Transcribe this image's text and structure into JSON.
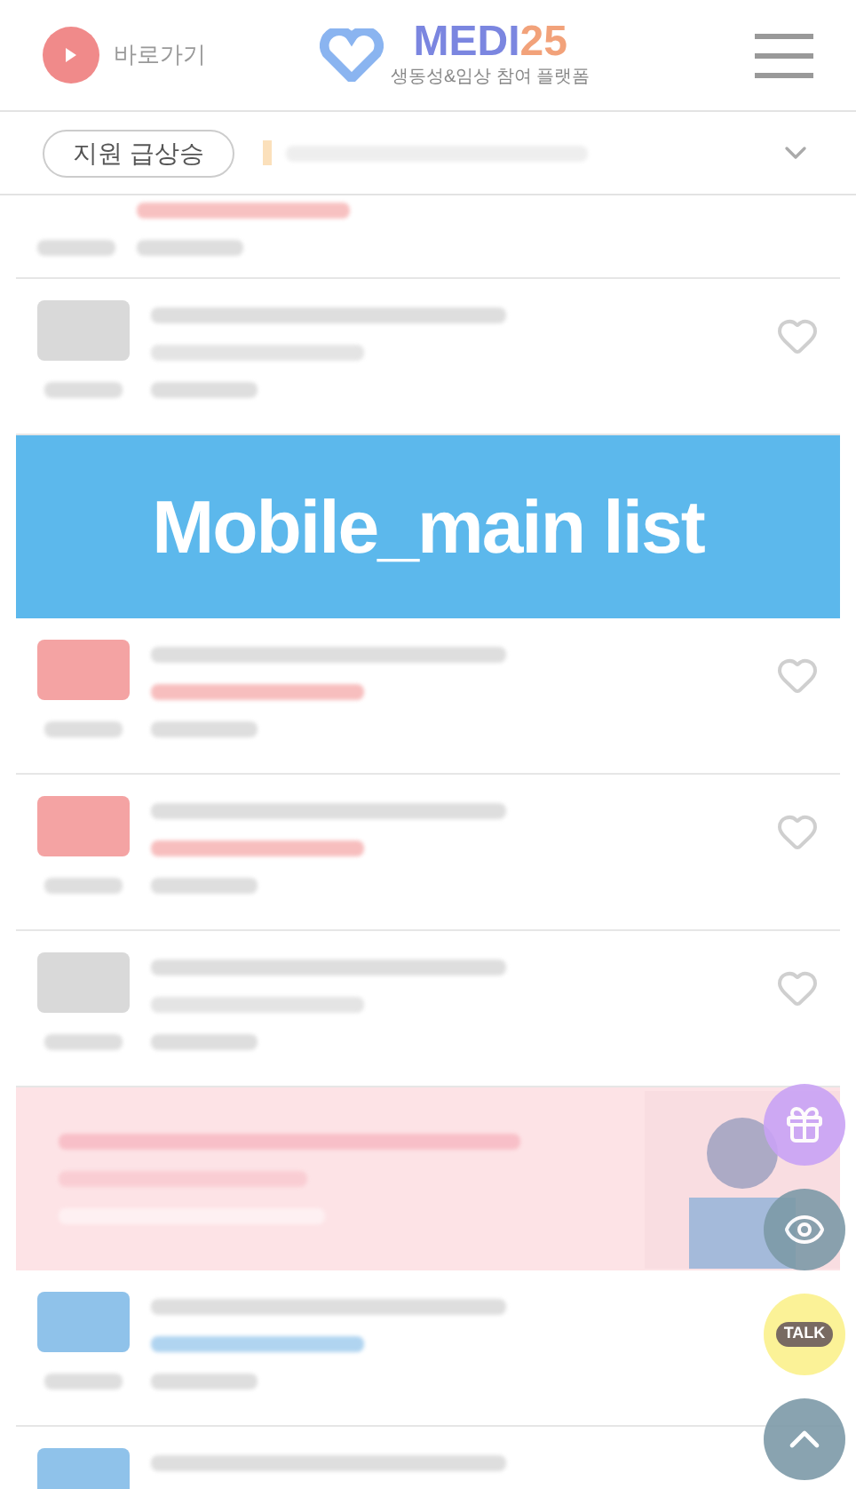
{
  "header": {
    "shortcut": "바로가기",
    "logo_main": "MEDI",
    "logo_number": "25",
    "logo_tagline": "생동성&임상 참여 플랫폼"
  },
  "ticker": {
    "tag": "지원 급상승"
  },
  "list": [
    {
      "kind": "partial"
    },
    {
      "kind": "row",
      "color": "#d9d9d9"
    },
    {
      "kind": "banner"
    },
    {
      "kind": "row",
      "color": "#f4a3a3"
    },
    {
      "kind": "row",
      "color": "#f4a3a3"
    },
    {
      "kind": "row",
      "color": "#d9d9d9"
    },
    {
      "kind": "ad"
    },
    {
      "kind": "row",
      "color": "#8fc2ea"
    },
    {
      "kind": "row",
      "color": "#8fc2ea"
    }
  ],
  "overlay_label": "Mobile_main list",
  "floating_buttons": [
    {
      "kind": "gift"
    },
    {
      "kind": "eye"
    },
    {
      "kind": "talk",
      "label": "TALK"
    },
    {
      "kind": "top"
    }
  ]
}
